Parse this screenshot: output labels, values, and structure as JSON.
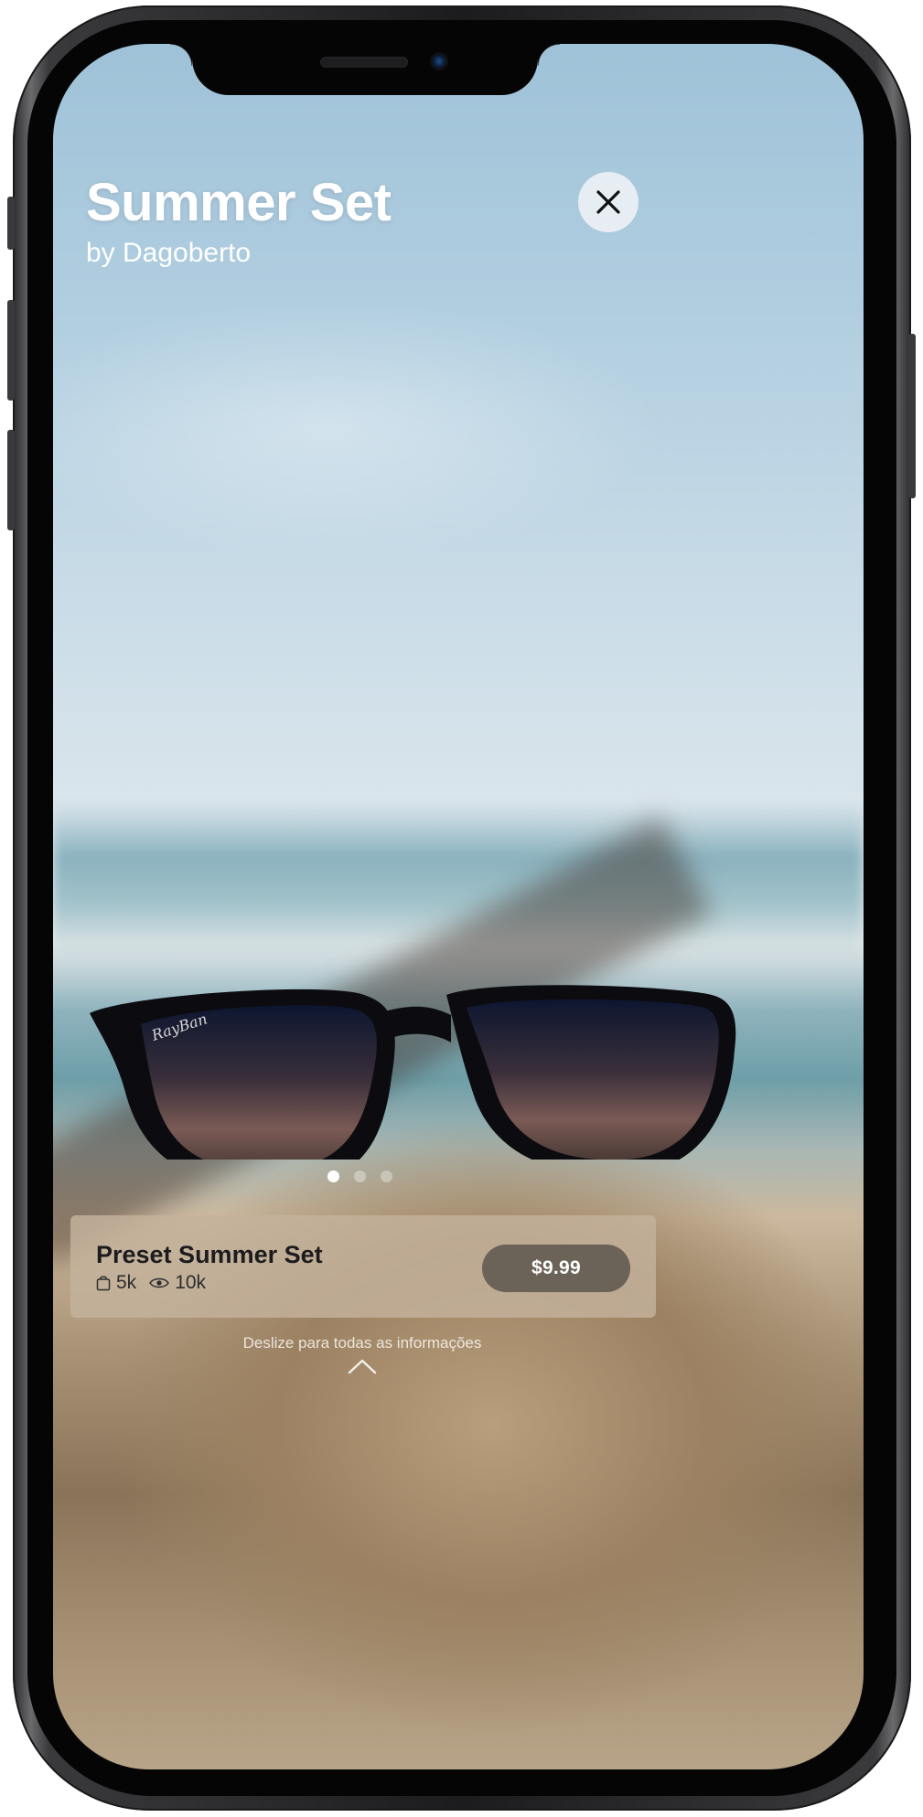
{
  "header": {
    "title": "Summer Set",
    "subtitle": "by Dagoberto"
  },
  "close_button": {
    "icon": "close-icon"
  },
  "carousel": {
    "total": 3,
    "active_index": 0
  },
  "product_card": {
    "name": "Preset Summer Set",
    "downloads": "5k",
    "views": "10k",
    "price": "$9.99",
    "icons": [
      "bag-icon",
      "eye-icon"
    ]
  },
  "footer": {
    "swipe_hint": "Deslize para todas as informações",
    "icon": "chevron-up-icon"
  },
  "colors": {
    "price_button": "#6b6258",
    "card_background": "#c4b29c",
    "title_text": "#ffffff"
  }
}
